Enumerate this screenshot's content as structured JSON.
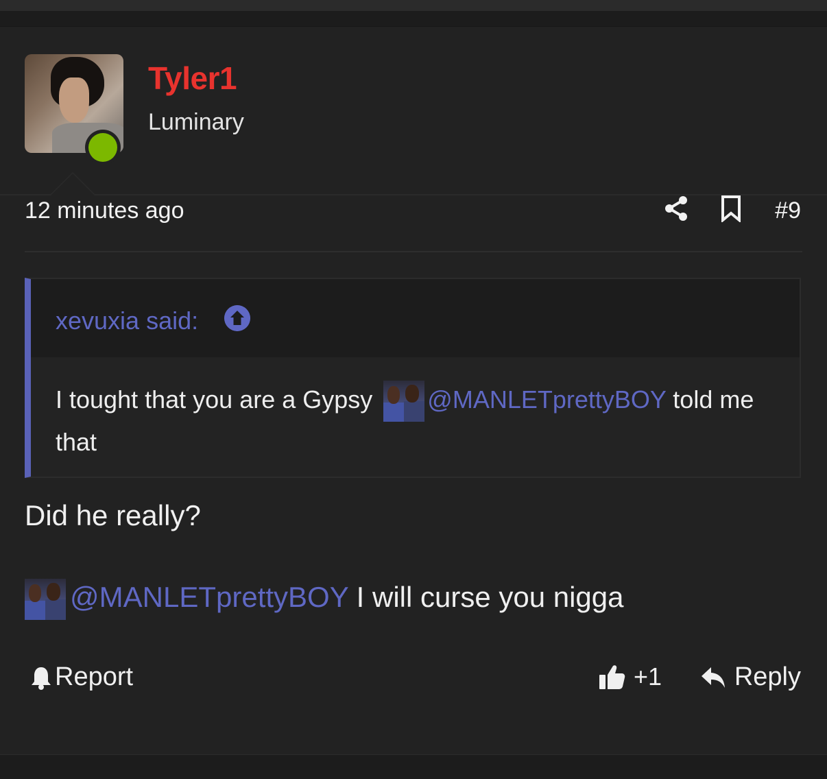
{
  "post": {
    "author": {
      "username": "Tyler1",
      "title": "Luminary",
      "username_color": "#e8332e",
      "online_status_color": "#7cb800"
    },
    "meta": {
      "timestamp": "12 minutes ago",
      "post_number": "#9",
      "icons": [
        "share-icon",
        "bookmark-icon"
      ]
    },
    "quote": {
      "author_label": "xevuxia said:",
      "text_before": "I tought that you are a Gypsy",
      "mention": "@MANLETprettyBOY",
      "text_after": "told me that",
      "accent_color": "#5f68c4"
    },
    "body": {
      "line1": "Did he really?",
      "mention": "@MANLETprettyBOY",
      "line2_after": "I will curse you nigga"
    },
    "actions": {
      "report_label": "Report",
      "like_count": "+1",
      "reply_label": "Reply"
    }
  }
}
